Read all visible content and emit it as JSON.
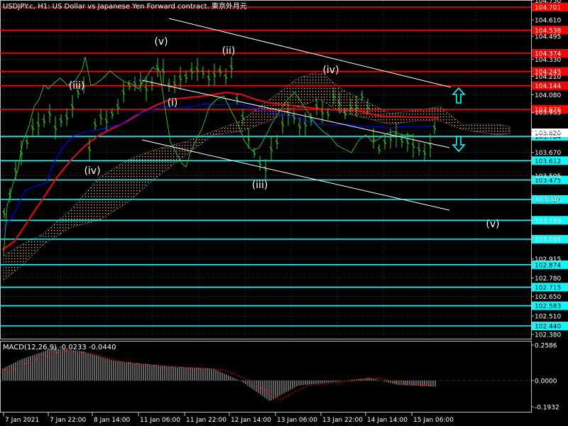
{
  "header": {
    "title": "USDJPY.c, H1:  US Dollar vs Japanese Yen Forward contract. 東京外月元"
  },
  "chart_data": {
    "type": "line",
    "symbol": "USDJPY.c",
    "timeframe": "H1",
    "price_ticks": [
      "104.750",
      "104.610",
      "104.495",
      "104.330",
      "104.210",
      "104.080",
      "103.955",
      "103.820",
      "103.670",
      "103.505",
      "103.340",
      "103.189",
      "103.055",
      "102.915",
      "102.780",
      "102.650",
      "102.510",
      "102.380"
    ],
    "x_ticks": [
      "7 Jan 2021",
      "7 Jan 22:00",
      "8 Jan 14:00",
      "11 Jan 06:00",
      "11 Jan 22:00",
      "12 Jan 14:00",
      "13 Jan 06:00",
      "13 Jan 22:00",
      "14 Jan 14:00",
      "15 Jan 06:00"
    ],
    "resistance_levels": [
      {
        "price": 104.701,
        "label": "104.701"
      },
      {
        "price": 104.538,
        "label": "104.538"
      },
      {
        "price": 104.374,
        "label": "104.374"
      },
      {
        "price": 104.245,
        "label": "104.245"
      },
      {
        "price": 104.144,
        "label": "104.144"
      },
      {
        "price": 103.976,
        "label": "103.976"
      }
    ],
    "support_levels": [
      {
        "price": 103.784,
        "label": "103.784"
      },
      {
        "price": 103.612,
        "label": "103.612"
      },
      {
        "price": 103.475,
        "label": "103.475"
      },
      {
        "price": 103.337,
        "label": "103.337"
      },
      {
        "price": 103.189,
        "label": "103.189"
      },
      {
        "price": 103.055,
        "label": "103.055"
      },
      {
        "price": 102.874,
        "label": "102.874"
      },
      {
        "price": 102.715,
        "label": "102.715"
      },
      {
        "price": 102.583,
        "label": "102.583"
      },
      {
        "price": 102.44,
        "label": "102.440"
      }
    ],
    "current_price": {
      "label": "103.820"
    },
    "wave_labels": [
      {
        "text": "(iii)"
      },
      {
        "text": "(iv)"
      },
      {
        "text": "(v)"
      },
      {
        "text": "(i)"
      },
      {
        "text": "(ii)"
      },
      {
        "text": "(iii)"
      },
      {
        "text": "(iv)"
      },
      {
        "text": "(v)"
      }
    ],
    "macd": {
      "label": "MACD(12,26,9) -0.0233 -0.0440",
      "ticks": [
        "0.2586",
        "0.0000",
        "-0.1932"
      ]
    },
    "colors": {
      "background": "#000000",
      "price": "#32cd32",
      "resistance": "#ff0000",
      "support": "#00ffff",
      "ma_fast": "#0000ff",
      "ma_slow": "#ff0000",
      "ichimoku_cloud": "#ffdab9",
      "trendline": "#ffffff",
      "grid": "#c0c0c0"
    },
    "grid": true
  }
}
